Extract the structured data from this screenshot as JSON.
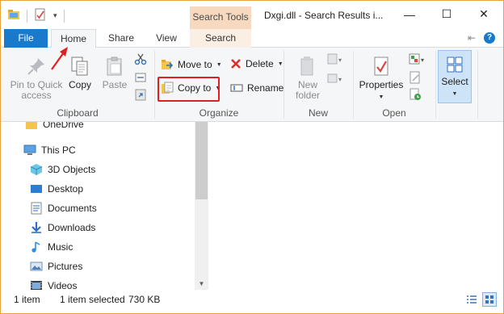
{
  "window": {
    "title": "Dxgi.dll - Search Results i...",
    "contextual_tab_header": "Search Tools",
    "controls": {
      "minimize": "—",
      "maximize": "☐",
      "close": "✕"
    }
  },
  "tabs": {
    "file": "File",
    "home": "Home",
    "share": "Share",
    "view": "View",
    "search": "Search",
    "pin_glyph": "⇤",
    "help_glyph": "?"
  },
  "ribbon": {
    "clipboard": {
      "group_label": "Clipboard",
      "pin_to_quick_access": [
        "Pin to Quick",
        "access"
      ],
      "copy": "Copy",
      "paste": "Paste"
    },
    "organize": {
      "group_label": "Organize",
      "move_to": "Move to",
      "copy_to": "Copy to",
      "delete": "Delete",
      "rename": "Rename"
    },
    "new": {
      "group_label": "New",
      "new_folder": [
        "New",
        "folder"
      ]
    },
    "open": {
      "group_label": "Open",
      "properties": "Properties"
    },
    "select": {
      "label": "Select"
    }
  },
  "nav": {
    "items": [
      {
        "label": "OneDrive",
        "icon": "folder-icon"
      },
      {
        "label": "This PC",
        "icon": "computer-icon"
      },
      {
        "label": "3D Objects",
        "icon": "cube-icon"
      },
      {
        "label": "Desktop",
        "icon": "desktop-icon"
      },
      {
        "label": "Documents",
        "icon": "documents-icon"
      },
      {
        "label": "Downloads",
        "icon": "download-icon"
      },
      {
        "label": "Music",
        "icon": "music-icon"
      },
      {
        "label": "Pictures",
        "icon": "pictures-icon"
      },
      {
        "label": "Videos",
        "icon": "videos-icon"
      }
    ]
  },
  "status": {
    "item_count": "1 item",
    "selection": "1 item selected",
    "size": "730 KB"
  },
  "colors": {
    "file_tab": "#1979ca",
    "search_tools": "#f7d9bf",
    "highlight_box": "#e02020",
    "window_border": "#e8a33c"
  }
}
